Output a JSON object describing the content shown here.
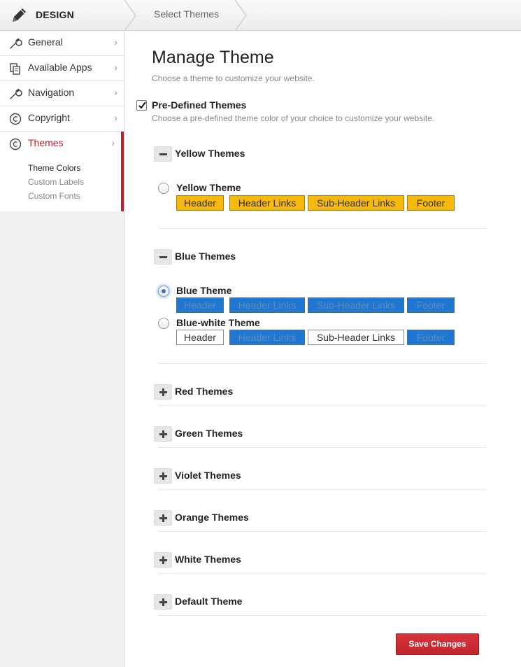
{
  "header": {
    "section_title": "DESIGN",
    "section_icon": "pencil-icon",
    "breadcrumb": "Select Themes"
  },
  "sidebar": {
    "items": [
      {
        "label": "General",
        "icon": "wrench-icon"
      },
      {
        "label": "Available Apps",
        "icon": "apps-icon"
      },
      {
        "label": "Navigation",
        "icon": "wrench-icon"
      },
      {
        "label": "Copyright",
        "icon": "copyright-icon"
      },
      {
        "label": "Themes",
        "icon": "copyright-icon",
        "active": true
      }
    ],
    "subitems": [
      "Theme Colors",
      "Custom Labels",
      "Custom Fonts"
    ],
    "current_subitem": "Theme Colors"
  },
  "main": {
    "title": "Manage Theme",
    "subtitle": "Choose a theme to customize your website.",
    "predefined": {
      "label": "Pre-Defined Themes",
      "checked": true,
      "description": "Choose a pre-defined theme color of your choice to customize your website."
    },
    "groups": [
      {
        "title": "Yellow Themes",
        "expanded": true,
        "themes": [
          {
            "name": "Yellow Theme",
            "selected": false,
            "swatches": [
              "Header",
              "Header Links",
              "Sub-Header Links",
              "Footer"
            ]
          }
        ]
      },
      {
        "title": "Blue Themes",
        "expanded": true,
        "themes": [
          {
            "name": "Blue Theme",
            "selected": true,
            "swatches": [
              "Header",
              "Header Links",
              "Sub-Header Links",
              "Footer"
            ]
          },
          {
            "name": "Blue-white Theme",
            "selected": false,
            "swatches": [
              "Header",
              "Header Links",
              "Sub-Header Links",
              "Footer"
            ]
          }
        ]
      },
      {
        "title": "Red Themes",
        "expanded": false
      },
      {
        "title": "Green Themes",
        "expanded": false
      },
      {
        "title": "Violet Themes",
        "expanded": false
      },
      {
        "title": "Orange Themes",
        "expanded": false
      },
      {
        "title": "White Themes",
        "expanded": false
      },
      {
        "title": "Default Theme",
        "expanded": false
      }
    ],
    "save_label": "Save Changes"
  },
  "colors": {
    "accent": "#b3262c",
    "yellow_swatch": "#f7b80c",
    "blue_swatch": "#1f77d2",
    "white_swatch": "#ffffff"
  }
}
